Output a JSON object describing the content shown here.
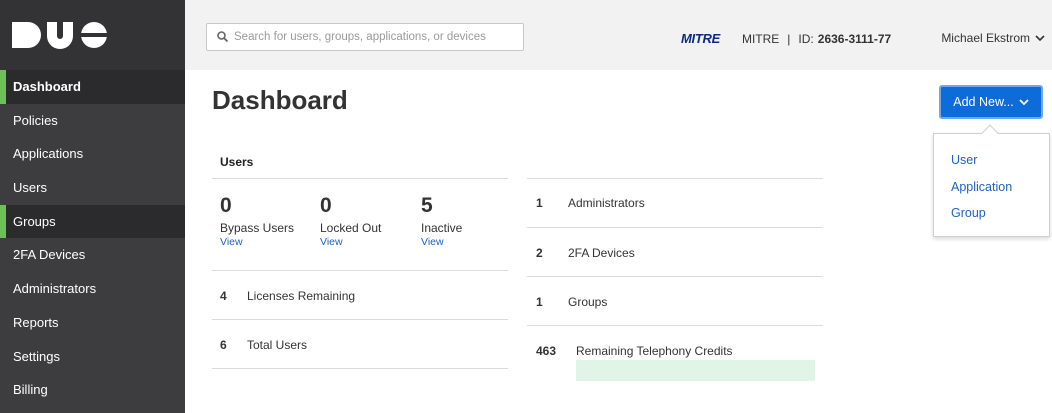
{
  "brand": {
    "logo_text": "DUO"
  },
  "sidebar": {
    "items": [
      {
        "label": "Dashboard"
      },
      {
        "label": "Policies"
      },
      {
        "label": "Applications"
      },
      {
        "label": "Users"
      },
      {
        "label": "Groups"
      },
      {
        "label": "2FA Devices"
      },
      {
        "label": "Administrators"
      },
      {
        "label": "Reports"
      },
      {
        "label": "Settings"
      },
      {
        "label": "Billing"
      }
    ]
  },
  "header": {
    "search_placeholder": "Search for users, groups, applications, or devices",
    "org_logo": "MITRE",
    "org_name": "MITRE",
    "separator": "|",
    "id_label": "ID:",
    "id_value": "2636-3111-77",
    "user_name": "Michael Ekstrom"
  },
  "main": {
    "title": "Dashboard",
    "add_button_label": "Add New...",
    "add_menu": [
      "User",
      "Application",
      "Group"
    ],
    "users_heading": "Users",
    "user_stats": [
      {
        "count": "0",
        "label": "Bypass Users",
        "link": "View"
      },
      {
        "count": "0",
        "label": "Locked Out",
        "link": "View"
      },
      {
        "count": "5",
        "label": "Inactive",
        "link": "View"
      }
    ],
    "left_rows": [
      {
        "count": "4",
        "label": "Licenses Remaining"
      },
      {
        "count": "6",
        "label": "Total Users"
      }
    ],
    "right_rows": [
      {
        "count": "1",
        "label": "Administrators"
      },
      {
        "count": "2",
        "label": "2FA Devices"
      },
      {
        "count": "1",
        "label": "Groups"
      },
      {
        "count": "463",
        "label": "Remaining Telephony Credits"
      }
    ]
  },
  "colors": {
    "sidebar_bg": "#3d3d40",
    "active_marker": "#6bc05a",
    "primary_button": "#0d6cd8",
    "link": "#1f61c4",
    "credits_bar": "#e1f4e8"
  }
}
